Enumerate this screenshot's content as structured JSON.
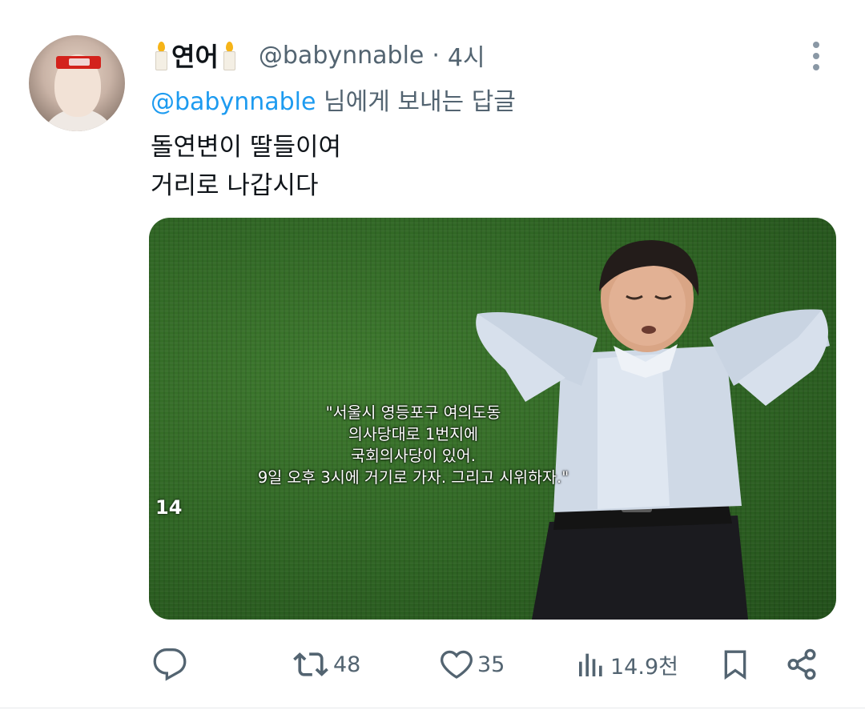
{
  "author": {
    "name": "연어",
    "handle": "@babynnable",
    "separator": "·",
    "time": "4시",
    "name_emoji": "candle"
  },
  "reply_to": {
    "mention": "@babynnable",
    "suffix": " 님에게 보내는 답글"
  },
  "tweet": {
    "lines": [
      "돌연변이 딸들이여",
      "거리로 나갑시다"
    ]
  },
  "media": {
    "caption_lines": [
      "\"서울시 영등포구 여의도동",
      "의사당대로 1번지에",
      "국회의사당이 있어.",
      "9일 오후 3시에 거기로 가자. 그리고 시위하자.\""
    ],
    "corner_mark": "14"
  },
  "actions": {
    "reply": {
      "icon": "reply-icon",
      "count": ""
    },
    "retweet": {
      "icon": "retweet-icon",
      "count": "48"
    },
    "like": {
      "icon": "heart-icon",
      "count": "35"
    },
    "views": {
      "icon": "views-icon",
      "count": "14.9천"
    },
    "bookmark": {
      "icon": "bookmark-icon"
    },
    "share": {
      "icon": "share-icon"
    }
  },
  "colors": {
    "accent": "#1d9bf0",
    "secondary_text": "#536471",
    "grass": "#2f6424"
  }
}
